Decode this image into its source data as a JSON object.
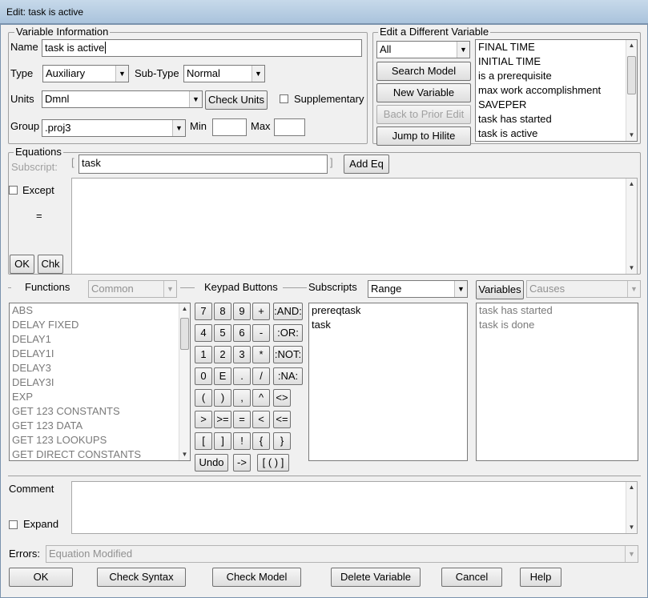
{
  "window": {
    "title": "Edit: task is active"
  },
  "variable_info": {
    "legend": "Variable Information",
    "name_label": "Name",
    "name_value": "task is active",
    "type_label": "Type",
    "type_value": "Auxiliary",
    "subtype_label": "Sub-Type",
    "subtype_value": "Normal",
    "units_label": "Units",
    "units_value": "Dmnl",
    "check_units": "Check Units",
    "supplementary": "Supplementary",
    "group_label": "Group",
    "group_value": ".proj3",
    "min_label": "Min",
    "max_label": "Max"
  },
  "edit_different": {
    "legend": "Edit a Different Variable",
    "filter_value": "All",
    "search_model": "Search Model",
    "new_variable": "New Variable",
    "back_prior": "Back to Prior Edit",
    "jump_hilite": "Jump to Hilite",
    "variables": [
      "FINAL TIME",
      "INITIAL TIME",
      "is a prerequisite",
      "max work accomplishment",
      "SAVEPER",
      "task has started",
      "task is active"
    ]
  },
  "equations": {
    "legend": "Equations",
    "subscript_label": "Subscript:",
    "subscript_value": "task",
    "add_eq": "Add Eq",
    "except_label": "Except",
    "equals": "=",
    "ok": "OK",
    "chk": "Chk"
  },
  "functions": {
    "label": "Functions",
    "category": "Common",
    "items": [
      "ABS",
      "DELAY FIXED",
      "DELAY1",
      "DELAY1I",
      "DELAY3",
      "DELAY3I",
      "EXP",
      "GET 123 CONSTANTS",
      "GET 123 DATA",
      "GET 123 LOOKUPS",
      "GET DIRECT CONSTANTS"
    ]
  },
  "keypad": {
    "label": "Keypad Buttons",
    "rows": [
      [
        "7",
        "8",
        "9",
        "+",
        ":AND:"
      ],
      [
        "4",
        "5",
        "6",
        "-",
        ":OR:"
      ],
      [
        "1",
        "2",
        "3",
        "*",
        ":NOT:"
      ],
      [
        "0",
        "E",
        ".",
        "/",
        ":NA:"
      ],
      [
        "(",
        ")",
        ",",
        "^",
        "<>"
      ],
      [
        ">",
        ">=",
        "=",
        "<",
        "<="
      ],
      [
        "[",
        "]",
        "!",
        "{",
        "}"
      ]
    ],
    "undo": "Undo",
    "arrow": "->",
    "paren_pair": "[ ( ) ]"
  },
  "subscripts": {
    "label": "Subscripts",
    "mode": "Range",
    "items": [
      "prereqtask",
      "task"
    ]
  },
  "variables_panel": {
    "button": "Variables",
    "mode": "Causes",
    "items": [
      "task has started",
      "task is done"
    ]
  },
  "comment": {
    "label": "Comment",
    "expand": "Expand"
  },
  "errors": {
    "label": "Errors:",
    "value": "Equation Modified"
  },
  "bottom": {
    "ok": "OK",
    "check_syntax": "Check Syntax",
    "check_model": "Check Model",
    "delete_variable": "Delete Variable",
    "cancel": "Cancel",
    "help": "Help"
  }
}
